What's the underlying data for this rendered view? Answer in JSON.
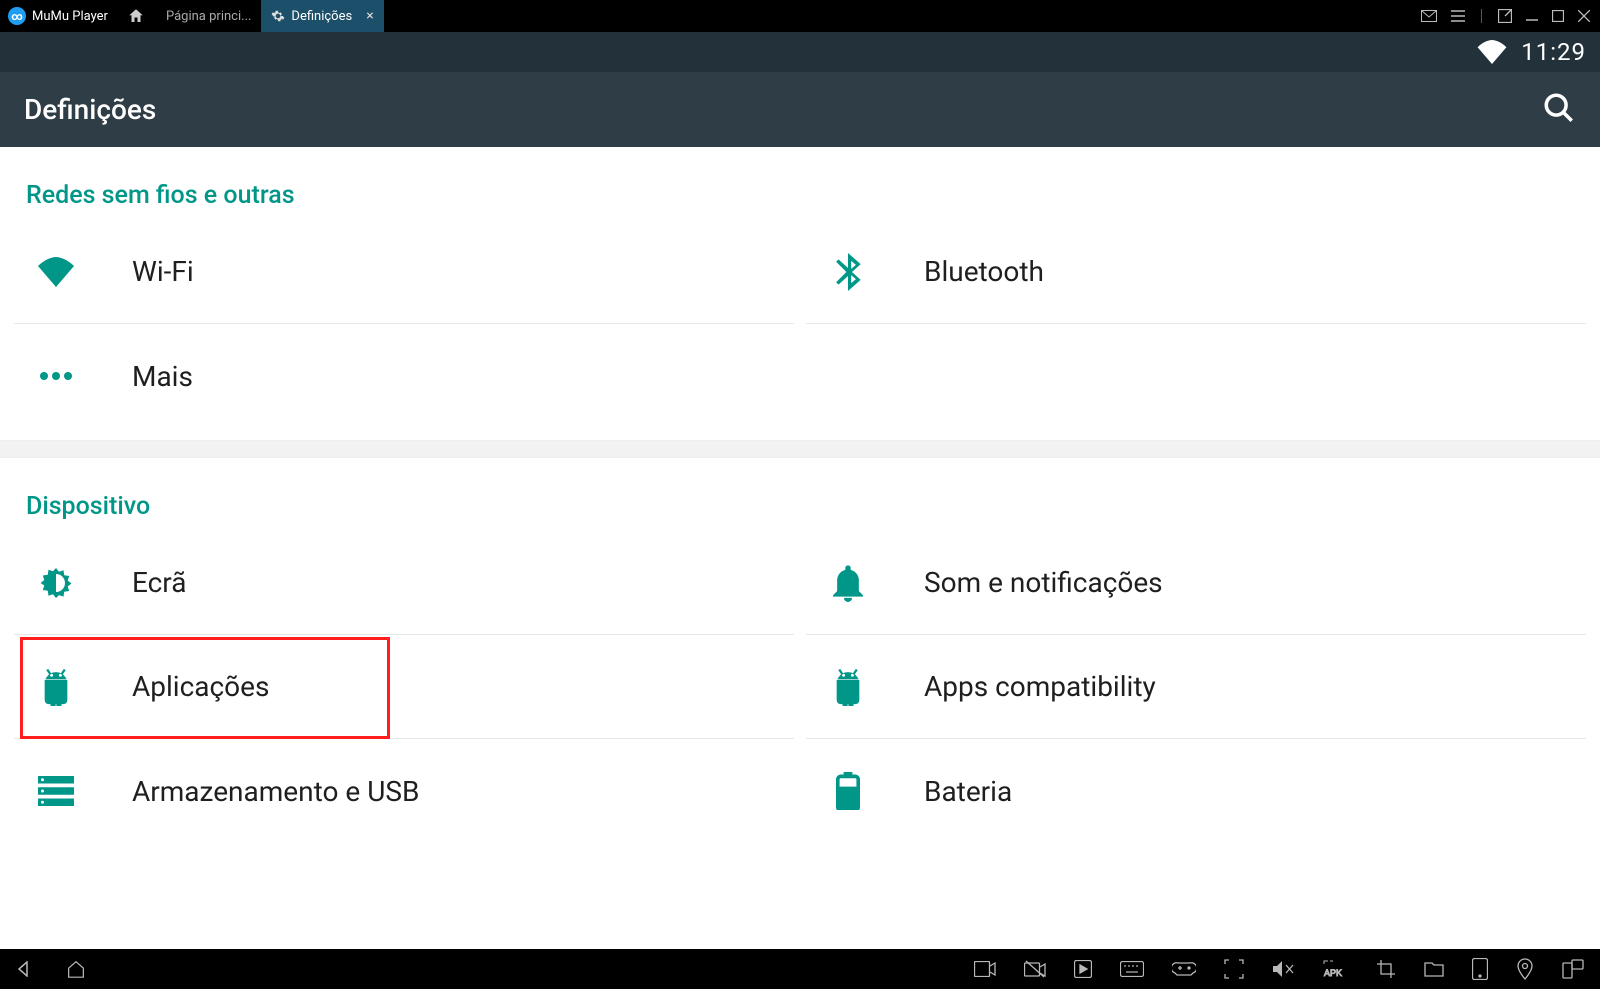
{
  "chrome": {
    "app_name": "MuMu Player",
    "tab_home_label": "Página princi...",
    "tab_active_label": "Definições"
  },
  "status": {
    "time": "11:29"
  },
  "appbar": {
    "title": "Definições"
  },
  "sections": {
    "network": {
      "header": "Redes sem fios e outras",
      "items": {
        "wifi": "Wi-Fi",
        "bluetooth": "Bluetooth",
        "more": "Mais"
      }
    },
    "device": {
      "header": "Dispositivo",
      "items": {
        "display": "Ecrã",
        "sound": "Som e notificações",
        "apps": "Aplicações",
        "apps_compat": "Apps compatibility",
        "storage": "Armazenamento e USB",
        "battery": "Bateria"
      }
    }
  },
  "colors": {
    "teal": "#009688",
    "highlight": "#ff1d1d"
  }
}
